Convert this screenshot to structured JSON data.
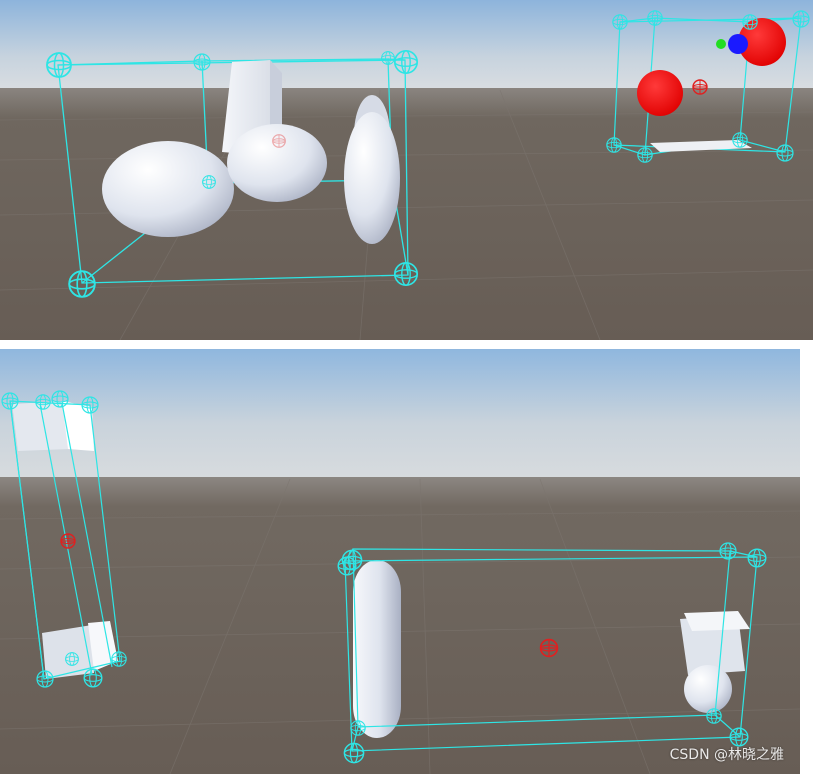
{
  "watermark": "CSDN @林晓之雅",
  "colors": {
    "gizmo_cyan": "#2ee5e5",
    "pivot_red": "#e02020",
    "sky_top": "#8fb6de",
    "horizon": "#d6dbe0",
    "ground": "#6b635c",
    "object_white": "#e8ecf3",
    "sphere_red": "#ff0000",
    "sphere_blue": "#1a1aff",
    "sphere_green": "#22dd22"
  },
  "views": [
    {
      "name": "top-scene-view",
      "content": [
        "bounding-box-gizmo",
        "white-capsules-and-box",
        "red-blue-green-spheres"
      ]
    },
    {
      "name": "bottom-scene-view",
      "content": [
        "tall-box-gizmo",
        "capsule-cube-sphere-gizmo"
      ]
    }
  ]
}
